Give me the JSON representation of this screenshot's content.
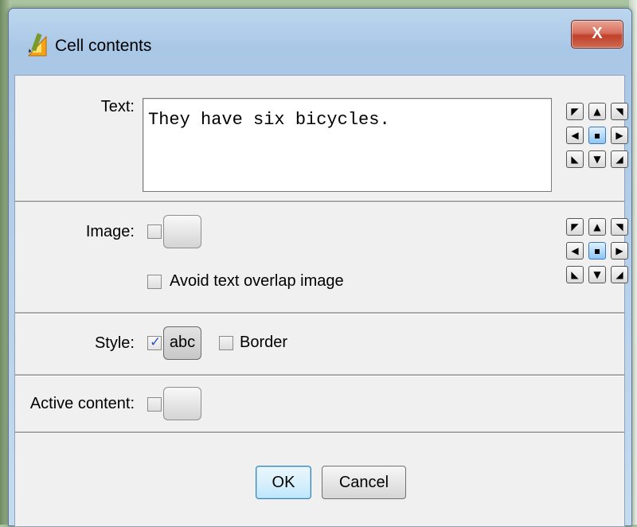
{
  "window": {
    "title": "Cell contents",
    "close_label": "X",
    "icon": "app-pencil-icon"
  },
  "text_section": {
    "label": "Text:",
    "value": "They have six bicycles."
  },
  "alignment_buttons": {
    "icons": [
      "align-top-left-icon",
      "align-top-icon",
      "align-top-right-icon",
      "align-left-icon",
      "align-center-icon",
      "align-right-icon",
      "align-bottom-left-icon",
      "align-bottom-icon",
      "align-bottom-right-icon"
    ],
    "text_selected": "center",
    "image_selected": "center"
  },
  "image_section": {
    "label": "Image:",
    "checked": false,
    "avoid_overlap_label": "Avoid text overlap image",
    "avoid_overlap_checked": false
  },
  "style_section": {
    "label": "Style:",
    "checked": true,
    "style_button_label": "abc",
    "border_label": "Border",
    "border_checked": false
  },
  "active_section": {
    "label": "Active content:",
    "checked": false
  },
  "buttons": {
    "ok": "OK",
    "cancel": "Cancel"
  },
  "colors": {
    "selected_align": "#8ec6f4",
    "close_button": "#c0402b",
    "checkmark": "#2b56c8"
  }
}
